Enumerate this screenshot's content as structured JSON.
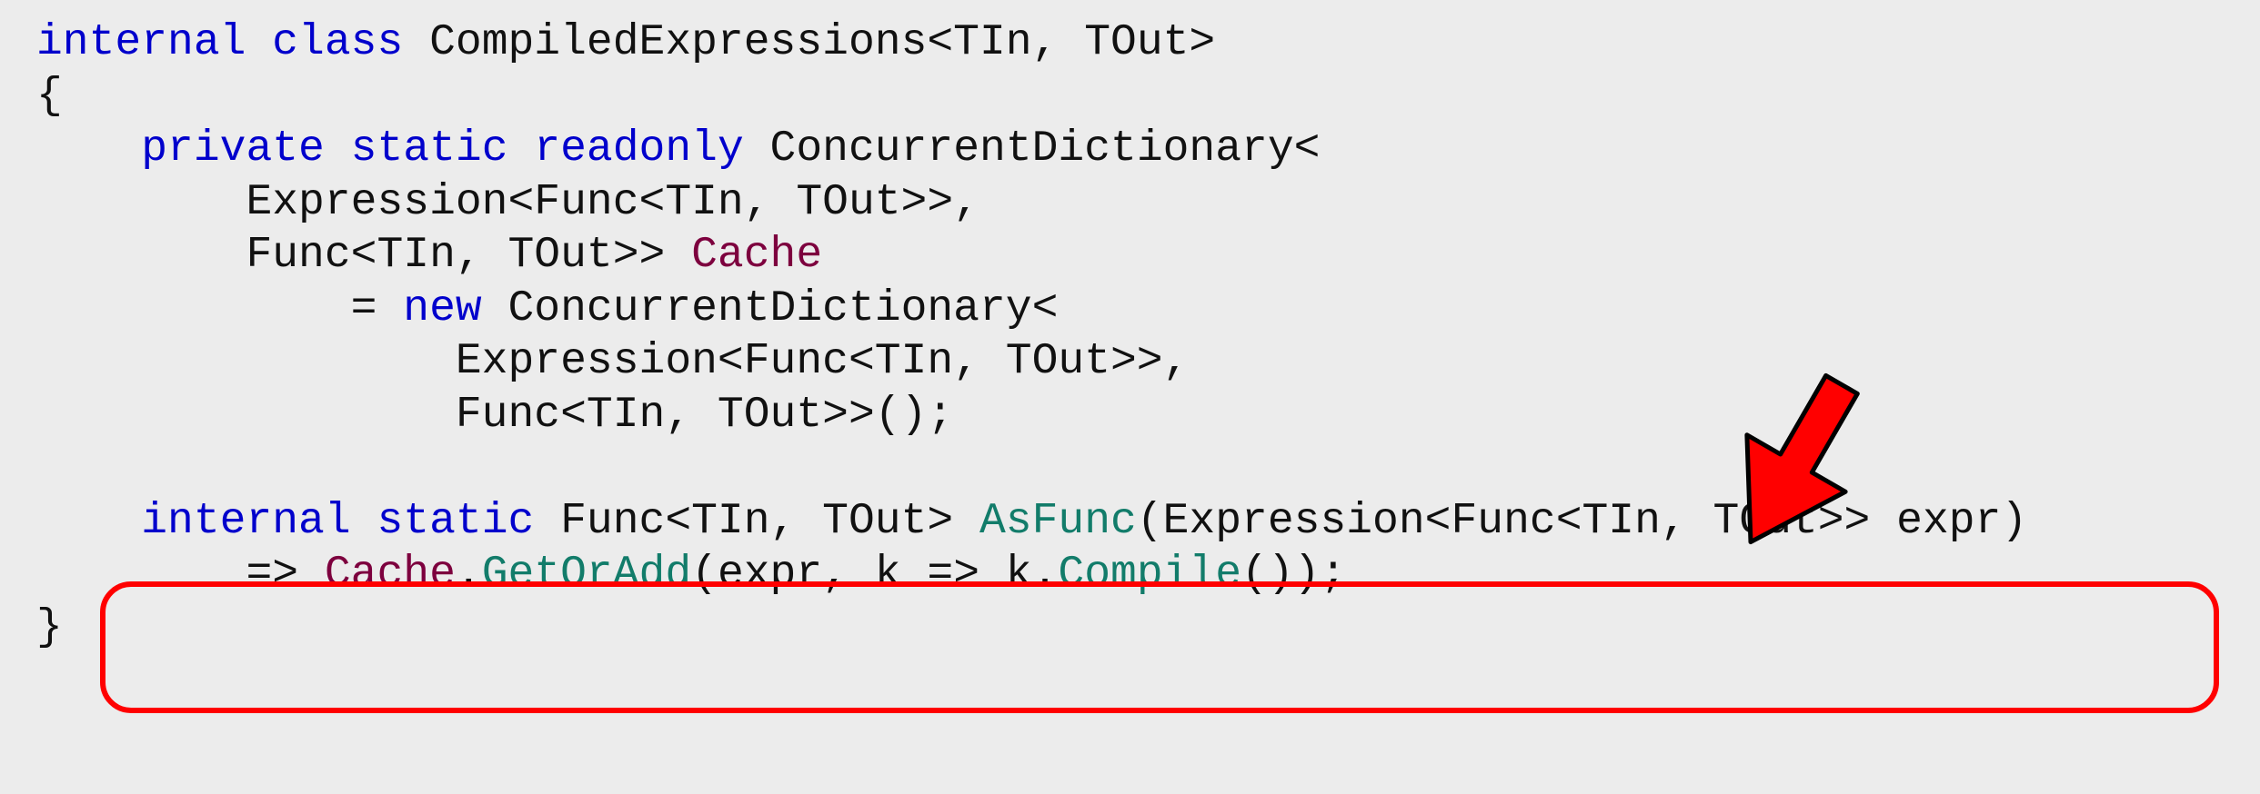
{
  "code": {
    "l1_kw1": "internal",
    "l1_kw2": "class",
    "l1_rest": " CompiledExpressions<TIn, TOut>",
    "l2": "{",
    "l3_kw1": "private",
    "l3_kw2": "static",
    "l3_kw3": "readonly",
    "l3_rest": " ConcurrentDictionary<",
    "l4": "        Expression<Func<TIn, TOut>>,",
    "l5_a": "        Func<TIn, TOut>> ",
    "l5_member": "Cache",
    "l6_a": "            = ",
    "l6_kw": "new",
    "l6_b": " ConcurrentDictionary<",
    "l7": "                Expression<Func<TIn, TOut>>,",
    "l8": "                Func<TIn, TOut>>();",
    "l9": "",
    "l10_kw1": "internal",
    "l10_kw2": "static",
    "l10_a": " Func<TIn, TOut> ",
    "l10_method": "AsFunc",
    "l10_b": "(Expression<Func<TIn, TOut>> expr)",
    "l11_a": "        => ",
    "l11_member": "Cache",
    "l11_b": ".",
    "l11_method1": "GetOrAdd",
    "l11_c": "(expr, k => k.",
    "l11_method2": "Compile",
    "l11_d": "());",
    "l12": "}"
  },
  "annotations": {
    "highlight": "AsFunc method",
    "arrow": "points to highlighted method"
  }
}
